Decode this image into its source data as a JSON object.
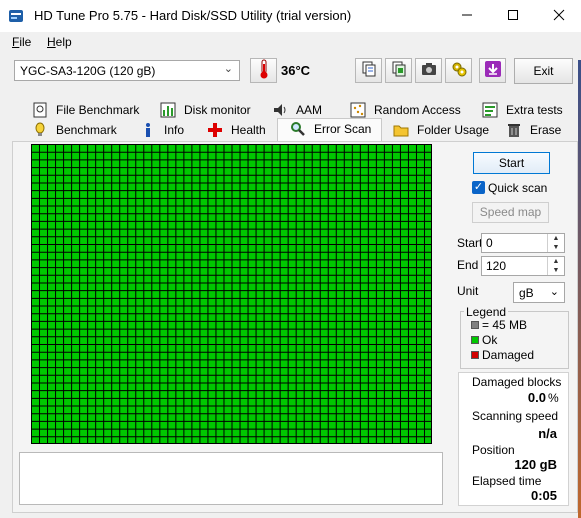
{
  "window": {
    "title": "HD Tune Pro 5.75 - Hard Disk/SSD Utility (trial version)",
    "minimize_icon": "minimize-icon",
    "maximize_icon": "maximize-icon",
    "close_icon": "close-icon"
  },
  "menu": [
    {
      "label": "File"
    },
    {
      "label": "Help"
    }
  ],
  "toolbar": {
    "drive": "YGC-SA3-120G (120 gB)",
    "temperature": "36°C",
    "icons": [
      "copy-text-icon",
      "copy-screenshot-icon",
      "camera-icon",
      "settings-icon",
      "download-icon"
    ],
    "exit_label": "Exit"
  },
  "tabs_row1": [
    {
      "label": "File Benchmark",
      "icon": "file-benchmark-icon"
    },
    {
      "label": "Disk monitor",
      "icon": "disk-monitor-icon"
    },
    {
      "label": "AAM",
      "icon": "speaker-icon"
    },
    {
      "label": "Random Access",
      "icon": "random-access-icon"
    },
    {
      "label": "Extra tests",
      "icon": "extra-tests-icon"
    }
  ],
  "tabs_row2": [
    {
      "label": "Benchmark",
      "icon": "benchmark-icon"
    },
    {
      "label": "Info",
      "icon": "info-icon"
    },
    {
      "label": "Health",
      "icon": "health-icon"
    },
    {
      "label": "Error Scan",
      "icon": "magnifier-icon",
      "active": true
    },
    {
      "label": "Folder Usage",
      "icon": "folder-icon"
    },
    {
      "label": "Erase",
      "icon": "trash-icon"
    }
  ],
  "scan": {
    "start_label": "Start",
    "quick_scan_label": "Quick scan",
    "quick_scan_checked": true,
    "speed_map_label": "Speed map",
    "start_field_label": "Start",
    "start_value": "0",
    "end_field_label": "End",
    "end_value": "120",
    "unit_label": "Unit",
    "unit_value": "gB",
    "grid_color": "#00c800",
    "grid_line_color": "#000000",
    "scan_progress": 1.0
  },
  "legend": {
    "title": "Legend",
    "items": [
      {
        "label": "= 45 MB",
        "color": "#808080"
      },
      {
        "label": "Ok",
        "color": "#00c800"
      },
      {
        "label": "Damaged",
        "color": "#d00000"
      }
    ]
  },
  "stats": {
    "damaged_label": "Damaged blocks",
    "damaged_value": "0.0",
    "damaged_unit": "%",
    "speed_label": "Scanning speed",
    "speed_value": "n/a",
    "position_label": "Position",
    "position_value": "120 gB",
    "elapsed_label": "Elapsed time",
    "elapsed_value": "0:05"
  }
}
